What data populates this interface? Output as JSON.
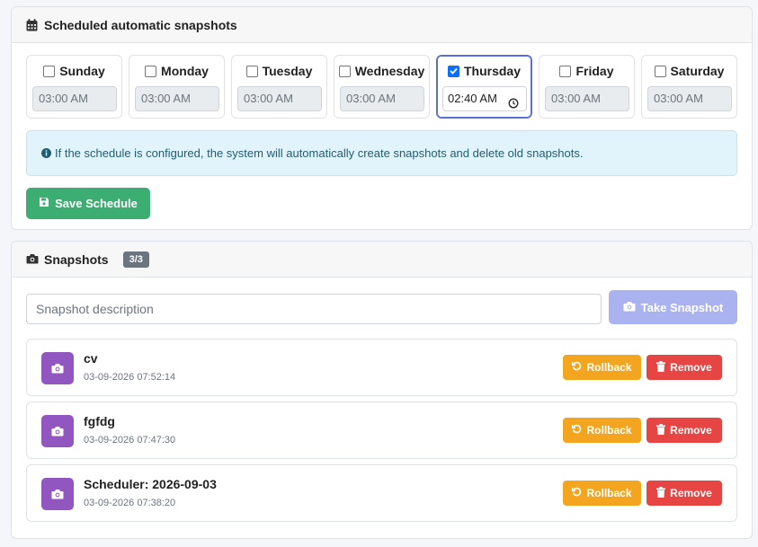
{
  "colors": {
    "accent": "#5a6fd6",
    "save": "#3dae72",
    "take": "#aab3f0",
    "rollback": "#f4a51f",
    "remove": "#e74444",
    "avatar": "#9256c0",
    "info_bg": "#e2f4fb"
  },
  "schedule": {
    "title": "Scheduled automatic snapshots",
    "icon": "calendar-icon",
    "days": [
      {
        "label": "Sunday",
        "checked": false,
        "time": "03:00 AM"
      },
      {
        "label": "Monday",
        "checked": false,
        "time": "03:00 AM"
      },
      {
        "label": "Tuesday",
        "checked": false,
        "time": "03:00 AM"
      },
      {
        "label": "Wednesday",
        "checked": false,
        "time": "03:00 AM"
      },
      {
        "label": "Thursday",
        "checked": true,
        "time": "02:40 AM"
      },
      {
        "label": "Friday",
        "checked": false,
        "time": "03:00 AM"
      },
      {
        "label": "Saturday",
        "checked": false,
        "time": "03:00 AM"
      }
    ],
    "info": "If the schedule is configured, the system will automatically create snapshots and delete old snapshots.",
    "save_label": "Save Schedule"
  },
  "snapshots": {
    "title": "Snapshots",
    "count": "3/3",
    "icon": "camera-icon",
    "placeholder": "Snapshot description",
    "take_label": "Take Snapshot",
    "rollback_label": "Rollback",
    "remove_label": "Remove",
    "items": [
      {
        "name": "cv",
        "date": "03-09-2026 07:52:14"
      },
      {
        "name": "fgfdg",
        "date": "03-09-2026 07:47:30"
      },
      {
        "name": "Scheduler: 2026-09-03",
        "date": "03-09-2026 07:38:20"
      }
    ]
  }
}
